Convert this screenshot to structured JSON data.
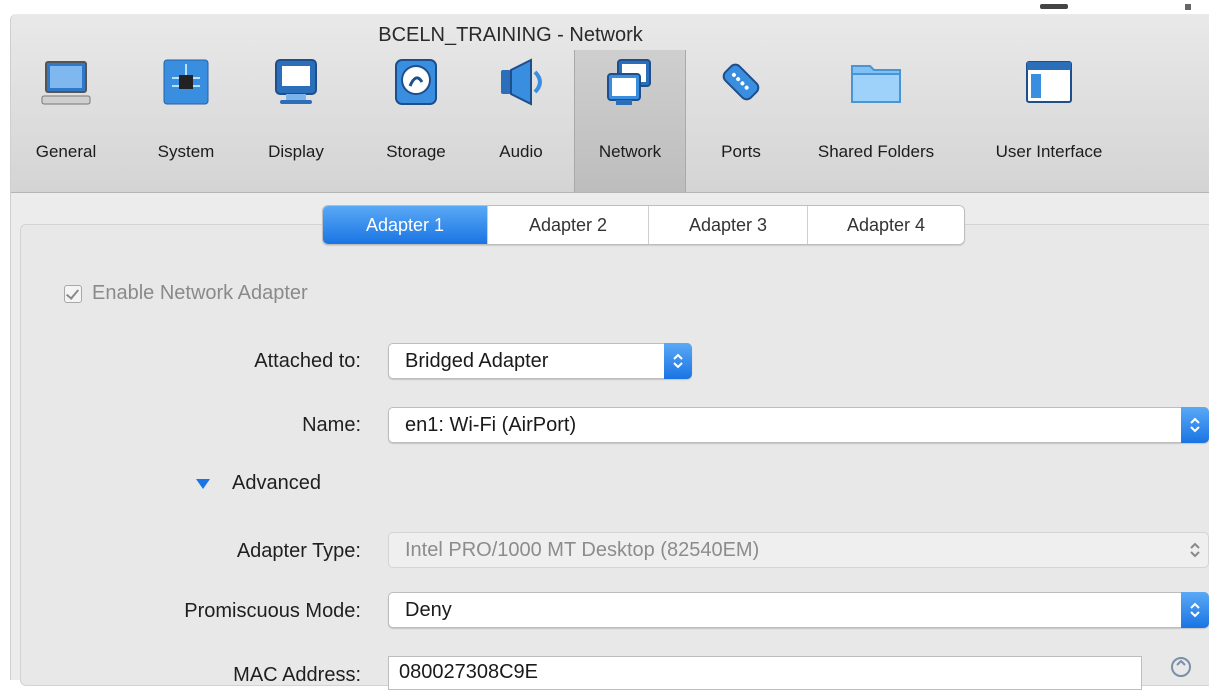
{
  "window": {
    "title": "BCELN_TRAINING - Network"
  },
  "toolbar": {
    "items": [
      {
        "label": "General",
        "icon": "monitor-icon"
      },
      {
        "label": "System",
        "icon": "chip-icon"
      },
      {
        "label": "Display",
        "icon": "display-icon"
      },
      {
        "label": "Storage",
        "icon": "disk-icon"
      },
      {
        "label": "Audio",
        "icon": "speaker-icon"
      },
      {
        "label": "Network",
        "icon": "network-icon"
      },
      {
        "label": "Ports",
        "icon": "serial-port-icon"
      },
      {
        "label": "Shared Folders",
        "icon": "folder-icon"
      },
      {
        "label": "User Interface",
        "icon": "window-icon"
      }
    ],
    "selected": "Network"
  },
  "tabs": [
    "Adapter 1",
    "Adapter 2",
    "Adapter 3",
    "Adapter 4"
  ],
  "active_tab": "Adapter 1",
  "form": {
    "enable_label": "Enable Network Adapter",
    "enable_checked": true,
    "attached_label": "Attached to:",
    "attached_value": "Bridged Adapter",
    "name_label": "Name:",
    "name_value": "en1: Wi-Fi (AirPort)",
    "advanced_label": "Advanced",
    "adapter_type_label": "Adapter Type:",
    "adapter_type_value": "Intel PRO/1000 MT Desktop (82540EM)",
    "promiscuous_label": "Promiscuous Mode:",
    "promiscuous_value": "Deny",
    "mac_label": "MAC Address:",
    "mac_value": "080027308C9E"
  },
  "colors": {
    "accent": "#1a74e3",
    "accent_light": "#5aa9f6",
    "toolbar_bg": "#dcdcdc",
    "panel_bg": "#e8e8e8"
  }
}
